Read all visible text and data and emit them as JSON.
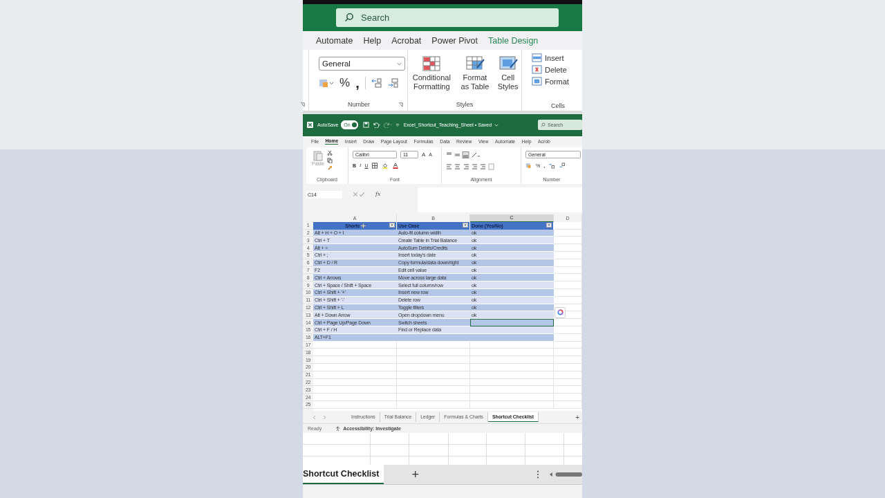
{
  "zoom_top": {
    "search": {
      "placeholder": "Search"
    },
    "tabs": [
      {
        "label": "Automate",
        "kind": "normal"
      },
      {
        "label": "Help",
        "kind": "normal"
      },
      {
        "label": "Acrobat",
        "kind": "normal"
      },
      {
        "label": "Power Pivot",
        "kind": "normal"
      },
      {
        "label": "Table Design",
        "kind": "contextual"
      }
    ],
    "number": {
      "format": "General",
      "percent": "%",
      "comma": ",",
      "label": "Number"
    },
    "styles": [
      {
        "label": "Conditional Formatting",
        "kind": "conditional"
      },
      {
        "label": "Format as Table",
        "kind": "table"
      },
      {
        "label": "Cell Styles",
        "kind": "cellstyles"
      }
    ],
    "styles_label": "Styles",
    "cells": [
      {
        "label": "Insert",
        "kind": "insert"
      },
      {
        "label": "Delete",
        "kind": "delete"
      },
      {
        "label": "Format",
        "kind": "format"
      }
    ],
    "cells_label": "Cells"
  },
  "excel": {
    "autosave_label": "AutoSave",
    "autosave": {
      "on": true,
      "label": "On"
    },
    "doc_title": "Excel_Shortcut_Teaching_Sheet • Saved",
    "search": {
      "placeholder": "Search"
    },
    "menu": [
      {
        "label": "File",
        "selected": false
      },
      {
        "label": "Home",
        "selected": true
      },
      {
        "label": "Insert",
        "selected": false
      },
      {
        "label": "Draw",
        "selected": false
      },
      {
        "label": "Page Layout",
        "selected": false
      },
      {
        "label": "Formulas",
        "selected": false
      },
      {
        "label": "Data",
        "selected": false
      },
      {
        "label": "Review",
        "selected": false
      },
      {
        "label": "View",
        "selected": false
      },
      {
        "label": "Automate",
        "selected": false
      },
      {
        "label": "Help",
        "selected": false
      },
      {
        "label": "Acrob",
        "selected": false
      }
    ],
    "clipboard": {
      "paste": "Paste",
      "label": "Clipboard"
    },
    "font": {
      "name": "Calibri",
      "size": "11",
      "grow": "A",
      "shrink": "A",
      "bold": "B",
      "italic": "I",
      "underline": "U",
      "label": "Font"
    },
    "alignment_label": "Alignment",
    "number": {
      "format": "General",
      "percent": "%",
      "comma": ",",
      "label": "Number"
    },
    "name_box": "C14",
    "fx": "fx",
    "columns": [
      {
        "label": "A",
        "selected": false
      },
      {
        "label": "B",
        "selected": false
      },
      {
        "label": "C",
        "selected": true
      },
      {
        "label": "D",
        "selected": false
      }
    ],
    "header_row": {
      "number": "1",
      "cells": [
        "Shortc",
        "Use Case",
        "Done (Yes/No)"
      ]
    },
    "rows": [
      {
        "number": "2",
        "cells": [
          "Alt + H + O + I",
          "Auto-fit column width",
          "ok"
        ],
        "selected": false
      },
      {
        "number": "3",
        "cells": [
          "Ctrl + T",
          "Create Table in Trial Balance",
          "ok"
        ],
        "selected": false
      },
      {
        "number": "4",
        "cells": [
          "Alt + =",
          "AutoSum Debits/Credits",
          "ok"
        ],
        "selected": false
      },
      {
        "number": "5",
        "cells": [
          "Ctrl + ;",
          "Insert today's date",
          "ok"
        ],
        "selected": false
      },
      {
        "number": "6",
        "cells": [
          "Ctrl + D / R",
          "Copy formula/data down/right",
          "ok"
        ],
        "selected": false
      },
      {
        "number": "7",
        "cells": [
          "F2",
          "Edit cell value",
          "ok"
        ],
        "selected": false
      },
      {
        "number": "8",
        "cells": [
          "Ctrl + Arrows",
          "Move across large data",
          "ok"
        ],
        "selected": false
      },
      {
        "number": "9",
        "cells": [
          "Ctrl + Space / Shift + Space",
          "Select full column/row",
          "ok"
        ],
        "selected": false
      },
      {
        "number": "10",
        "cells": [
          "Ctrl + Shift + '+'",
          "Insert new row",
          "ok"
        ],
        "selected": false
      },
      {
        "number": "11",
        "cells": [
          "Ctrl + Shift + '-'",
          "Delete row",
          "ok"
        ],
        "selected": false
      },
      {
        "number": "12",
        "cells": [
          "Ctrl + Shift + L",
          "Toggle filters",
          "ok"
        ],
        "selected": false
      },
      {
        "number": "13",
        "cells": [
          "Alt + Down Arrow",
          "Open dropdown menu",
          "ok"
        ],
        "selected": false
      },
      {
        "number": "14",
        "cells": [
          "Ctrl + Page Up/Page Down",
          "Switch sheets"
        ],
        "selected": true
      },
      {
        "number": "15",
        "cells": [
          "Ctrl + F / H",
          "Find or Replace data"
        ],
        "selected": false
      },
      {
        "number": "16",
        "cells": [
          "ALT+F1"
        ],
        "selected": false
      }
    ],
    "empty_rows": [
      "17",
      "18",
      "19",
      "20",
      "21",
      "22",
      "23",
      "24",
      "25"
    ],
    "sheet_tabs": [
      {
        "label": "Instructions",
        "selected": false
      },
      {
        "label": "Trial Balance",
        "selected": false
      },
      {
        "label": "Ledger",
        "selected": false
      },
      {
        "label": "Formulas & Charts",
        "selected": false
      },
      {
        "label": "Shortcut Checklist",
        "selected": true
      }
    ],
    "add_sheet": "+",
    "status": {
      "ready": "Ready",
      "accessibility": "Accessibility: Investigate"
    }
  },
  "zoom_bottom": {
    "tab": {
      "label": "Shortcut Checklist",
      "selected": true
    },
    "add": "+"
  }
}
